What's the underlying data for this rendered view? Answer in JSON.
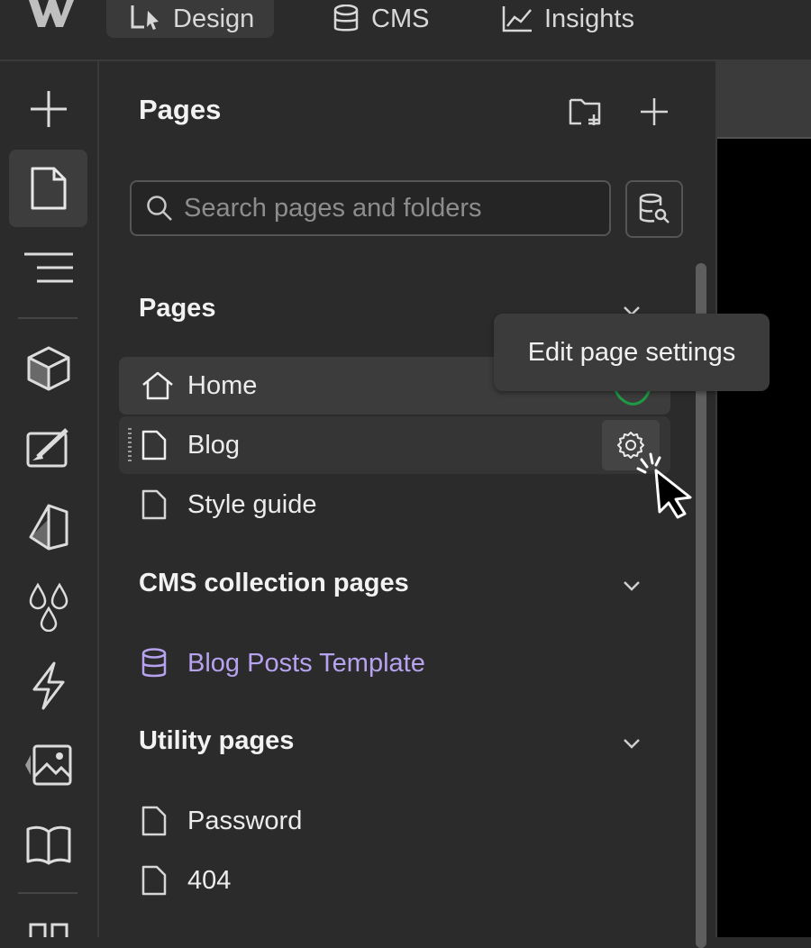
{
  "topbar": {
    "logo_icon": "webflow-logo-icon",
    "tabs": [
      {
        "label": "Design",
        "icon": "design-cursor-icon",
        "active": true
      },
      {
        "label": "CMS",
        "icon": "database-icon",
        "active": false
      },
      {
        "label": "Insights",
        "icon": "chart-line-icon",
        "active": false
      }
    ]
  },
  "rail": {
    "items": [
      "add-icon",
      "page-icon",
      "navigator-icon",
      "components-icon",
      "style-selector-icon",
      "variables-icon",
      "swatches-icon",
      "interactions-icon",
      "assets-icon",
      "docs-icon",
      "apps-icon"
    ]
  },
  "panel": {
    "title": "Pages",
    "search": {
      "placeholder": "Search pages and folders",
      "value": ""
    },
    "sections": {
      "pages": {
        "title": "Pages",
        "items": [
          {
            "label": "Home",
            "icon": "home-icon"
          },
          {
            "label": "Blog",
            "icon": "page-icon"
          },
          {
            "label": "Style guide",
            "icon": "page-icon"
          }
        ]
      },
      "cms": {
        "title": "CMS collection pages",
        "items": [
          {
            "label": "Blog Posts Template",
            "icon": "database-icon"
          }
        ]
      },
      "utility": {
        "title": "Utility pages",
        "items": [
          {
            "label": "Password",
            "icon": "page-icon"
          },
          {
            "label": "404",
            "icon": "page-icon"
          }
        ]
      }
    }
  },
  "tooltip": {
    "text": "Edit page settings"
  },
  "colors": {
    "background": "#2b2b2b",
    "accent_purple": "#b7a2f0",
    "canvas": "#000000"
  }
}
